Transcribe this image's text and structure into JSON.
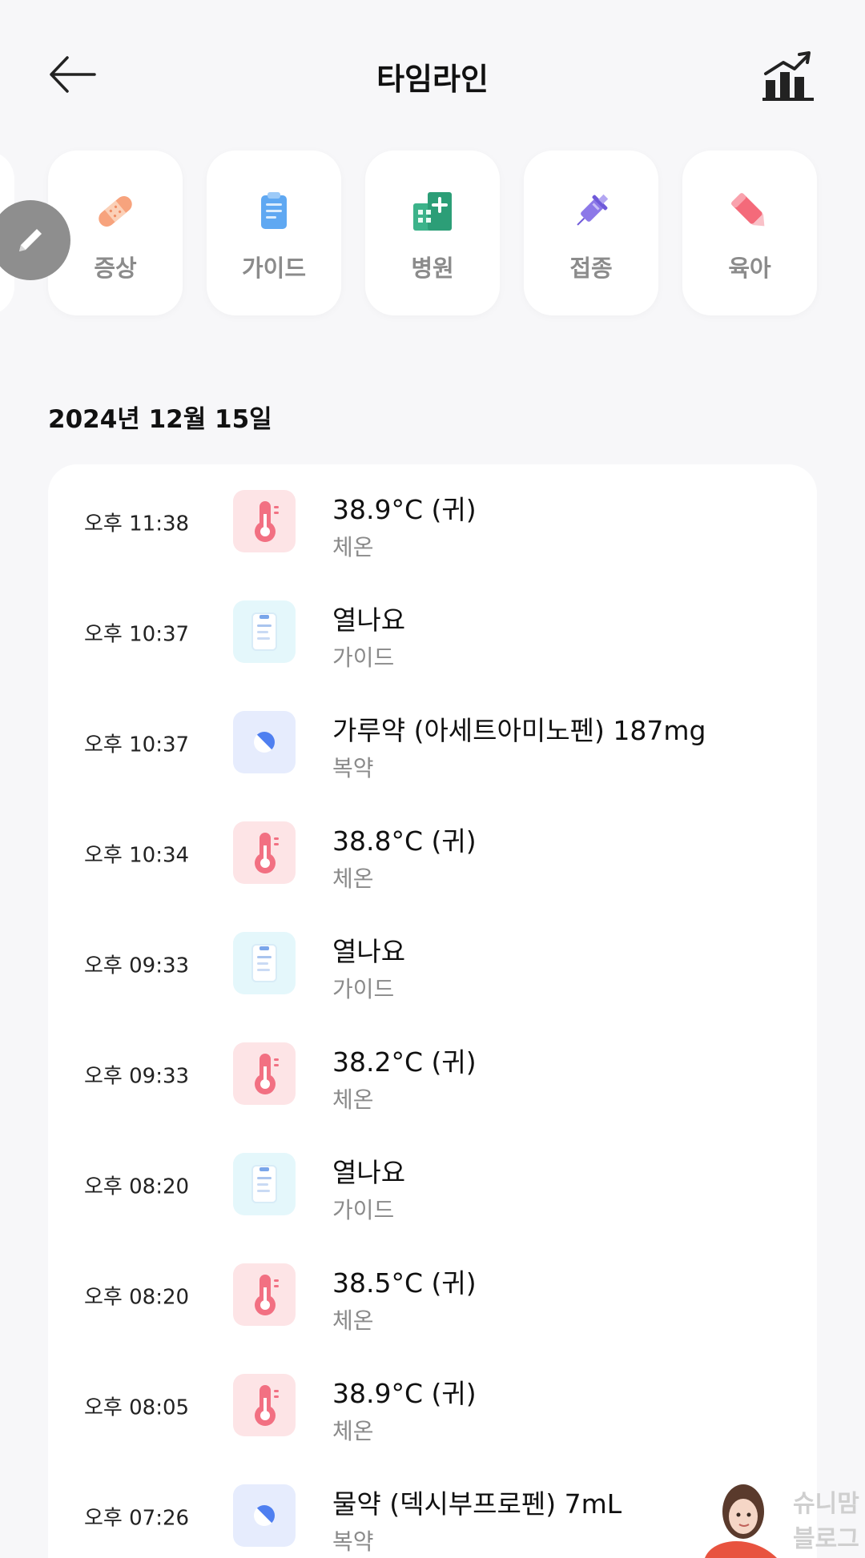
{
  "header": {
    "title": "타임라인",
    "back_icon": "arrow-left-icon",
    "chart_icon": "bar-chart-up-icon"
  },
  "categories": [
    {
      "label": "증상",
      "icon": "bandage-icon"
    },
    {
      "label": "가이드",
      "icon": "clipboard-icon"
    },
    {
      "label": "병원",
      "icon": "hospital-icon"
    },
    {
      "label": "접종",
      "icon": "syringe-icon"
    },
    {
      "label": "육아",
      "icon": "pencil-eraser-icon"
    }
  ],
  "edit_button": {
    "icon": "pencil-icon"
  },
  "timeline": {
    "date": "2024년 12월 15일",
    "entries": [
      {
        "time": "오후 11:38",
        "title": "38.9°C (귀)",
        "type": "체온",
        "kind": "temp"
      },
      {
        "time": "오후 10:37",
        "title": "열나요",
        "type": "가이드",
        "kind": "guide"
      },
      {
        "time": "오후 10:37",
        "title": "가루약 (아세트아미노펜) 187mg",
        "type": "복약",
        "kind": "med"
      },
      {
        "time": "오후 10:34",
        "title": "38.8°C (귀)",
        "type": "체온",
        "kind": "temp"
      },
      {
        "time": "오후 09:33",
        "title": "열나요",
        "type": "가이드",
        "kind": "guide"
      },
      {
        "time": "오후 09:33",
        "title": "38.2°C (귀)",
        "type": "체온",
        "kind": "temp"
      },
      {
        "time": "오후 08:20",
        "title": "열나요",
        "type": "가이드",
        "kind": "guide"
      },
      {
        "time": "오후 08:20",
        "title": "38.5°C (귀)",
        "type": "체온",
        "kind": "temp"
      },
      {
        "time": "오후 08:05",
        "title": "38.9°C (귀)",
        "type": "체온",
        "kind": "temp"
      },
      {
        "time": "오후 07:26",
        "title": "물약 (덱시부프로펜) 7mL",
        "type": "복약",
        "kind": "med"
      }
    ]
  },
  "watermark": {
    "line1": "슈니맘",
    "line2": "블로그"
  }
}
